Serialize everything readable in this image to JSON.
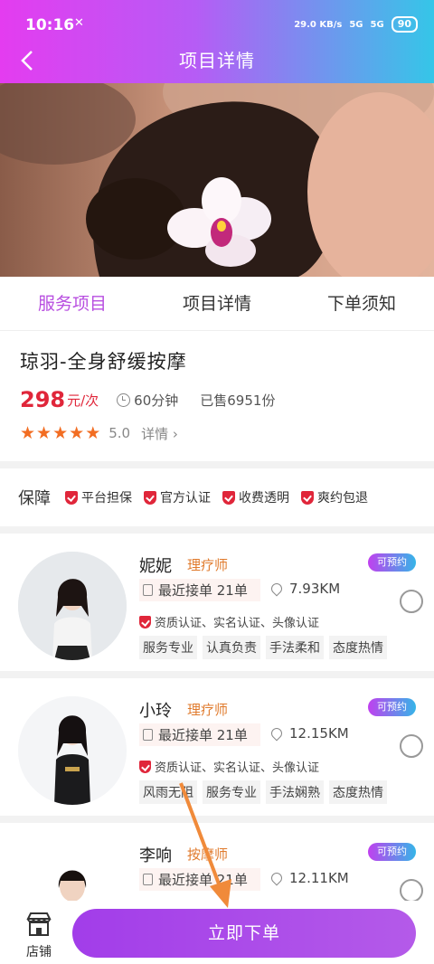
{
  "status": {
    "time": "10:16",
    "muted": "✕",
    "speed": "29.0 KB/s",
    "signal1": "5G",
    "signal2": "5G",
    "battery": "90"
  },
  "nav": {
    "back": "<",
    "title": "项目详情"
  },
  "tabs": [
    {
      "label": "服务项目"
    },
    {
      "label": "项目详情"
    },
    {
      "label": "下单须知"
    }
  ],
  "service": {
    "title": "琼羽-全身舒缓按摩",
    "price": "298",
    "price_unit": "元/次",
    "duration": "60分钟",
    "sold": "已售6951份",
    "rating": "5.0",
    "detail": "详情"
  },
  "guarantee": {
    "label": "保障",
    "items": [
      "平台担保",
      "官方认证",
      "收费透明",
      "爽约包退"
    ]
  },
  "therapists": [
    {
      "name": "妮妮",
      "role": "理疗师",
      "status": "可预约",
      "orders": "最近接单 21单",
      "distance": "7.93KM",
      "cert": "资质认证、实名认证、头像认证",
      "tags": [
        "服务专业",
        "认真负责",
        "手法柔和",
        "态度热情"
      ]
    },
    {
      "name": "小玲",
      "role": "理疗师",
      "status": "可预约",
      "orders": "最近接单 21单",
      "distance": "12.15KM",
      "cert": "资质认证、实名认证、头像认证",
      "tags": [
        "风雨无阻",
        "服务专业",
        "手法娴熟",
        "态度热情"
      ]
    },
    {
      "name": "李响",
      "role": "按摩师",
      "status": "可预约",
      "orders": "最近接单 21单",
      "distance": "12.11KM"
    }
  ],
  "bottom": {
    "shop_label": "店铺",
    "order_label": "立即下单"
  },
  "colors": {
    "accent": "#b84fe0",
    "price": "#e0263a",
    "role": "#e07a2c",
    "star": "#f26d22"
  }
}
